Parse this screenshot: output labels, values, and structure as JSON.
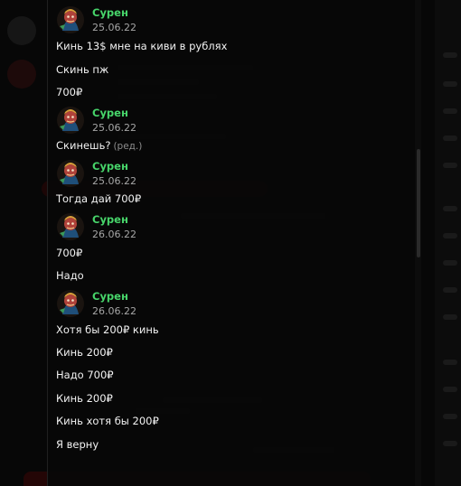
{
  "messages": [
    {
      "author": "Сурен",
      "date": "25.06.22",
      "lines": [
        {
          "text": "Кинь 13$ мне на киви в рублях"
        },
        {
          "text": "Скинь пж"
        },
        {
          "text": "700₽"
        }
      ]
    },
    {
      "author": "Сурен",
      "date": "25.06.22",
      "lines": [
        {
          "text": "Скинешь?",
          "edited": "(ред.)"
        }
      ]
    },
    {
      "author": "Сурен",
      "date": "25.06.22",
      "lines": [
        {
          "text": "Тогда дай 700₽"
        }
      ]
    },
    {
      "author": "Сурен",
      "date": "26.06.22",
      "lines": [
        {
          "text": "700₽"
        },
        {
          "text": "Надо"
        }
      ]
    },
    {
      "author": "Сурен",
      "date": "26.06.22",
      "lines": [
        {
          "text": "Хотя бы 200₽ кинь"
        },
        {
          "text": "Кинь 200₽"
        },
        {
          "text": "Надо 700₽"
        },
        {
          "text": "Кинь 200₽"
        },
        {
          "text": "Кинь хотя бы 200₽"
        },
        {
          "text": "Я верну"
        }
      ]
    }
  ],
  "colors": {
    "author": "#47d46a",
    "date": "#a6a6a6",
    "message_text": "#f2f2f2",
    "edited_mark": "#8d8d8d",
    "background": "#070707"
  },
  "icons": {
    "avatar": "avatar-icon"
  }
}
